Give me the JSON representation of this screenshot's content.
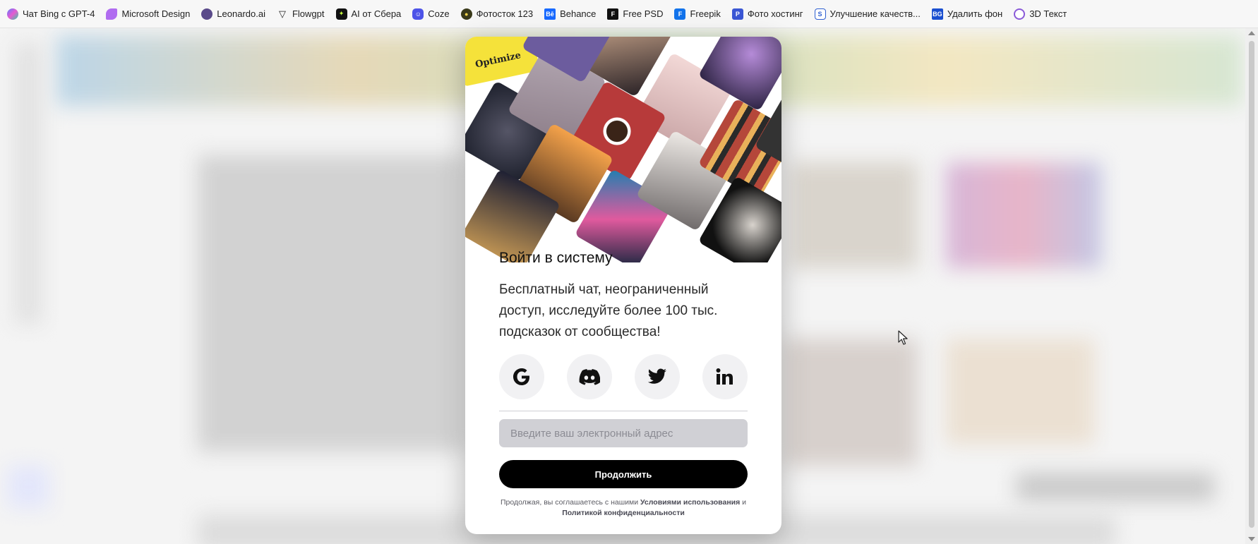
{
  "bookmarks": [
    {
      "label": "Чат Bing с GPT-4",
      "icon": "copilot-icon",
      "color": "#5b7cff"
    },
    {
      "label": "Microsoft Design",
      "icon": "microsoft-design-icon",
      "color": "#b06cf0"
    },
    {
      "label": "Leonardo.ai",
      "icon": "leonardo-icon",
      "color": "#5a4a8a"
    },
    {
      "label": "Flowgpt",
      "icon": "flowgpt-icon",
      "color": "#222222"
    },
    {
      "label": "AI от Сбера",
      "icon": "sber-ai-icon",
      "color": "#111111"
    },
    {
      "label": "Coze",
      "icon": "coze-icon",
      "color": "#4d53e8"
    },
    {
      "label": "Фотосток 123",
      "icon": "photostock-icon",
      "color": "#3a3a1a"
    },
    {
      "label": "Behance",
      "icon": "behance-icon",
      "color": "#1769ff"
    },
    {
      "label": "Free PSD",
      "icon": "freepsd-icon",
      "color": "#111111"
    },
    {
      "label": "Freepik",
      "icon": "freepik-icon",
      "color": "#1273eb"
    },
    {
      "label": "Фото хостинг",
      "icon": "photo-hosting-icon",
      "color": "#3a56d4"
    },
    {
      "label": "Улучшение качеств...",
      "icon": "enhance-icon",
      "color": "#2f5fd0"
    },
    {
      "label": "Удалить фон",
      "icon": "remove-bg-icon",
      "color": "#1a4fd0"
    },
    {
      "label": "3D Текст",
      "icon": "3d-text-icon",
      "color": "#8a5ad8"
    }
  ],
  "modal": {
    "title": "Войти в систему",
    "description": "Бесплатный чат, неограниченный доступ, исследуйте более 100 тыс. подсказок от сообщества!",
    "social_buttons": [
      {
        "name": "google",
        "icon": "google-icon"
      },
      {
        "name": "discord",
        "icon": "discord-icon"
      },
      {
        "name": "twitter",
        "icon": "twitter-icon"
      },
      {
        "name": "linkedin",
        "icon": "linkedin-icon"
      }
    ],
    "email_placeholder": "Введите ваш электронный адрес",
    "email_value": "",
    "continue_label": "Продолжить",
    "terms_prefix": "Продолжая, вы соглашаетесь с нашими",
    "terms_link": "Условиями использования",
    "terms_and": "и",
    "privacy_link": "Политикой конфиденциальности",
    "collage_badge": "Optimize"
  }
}
